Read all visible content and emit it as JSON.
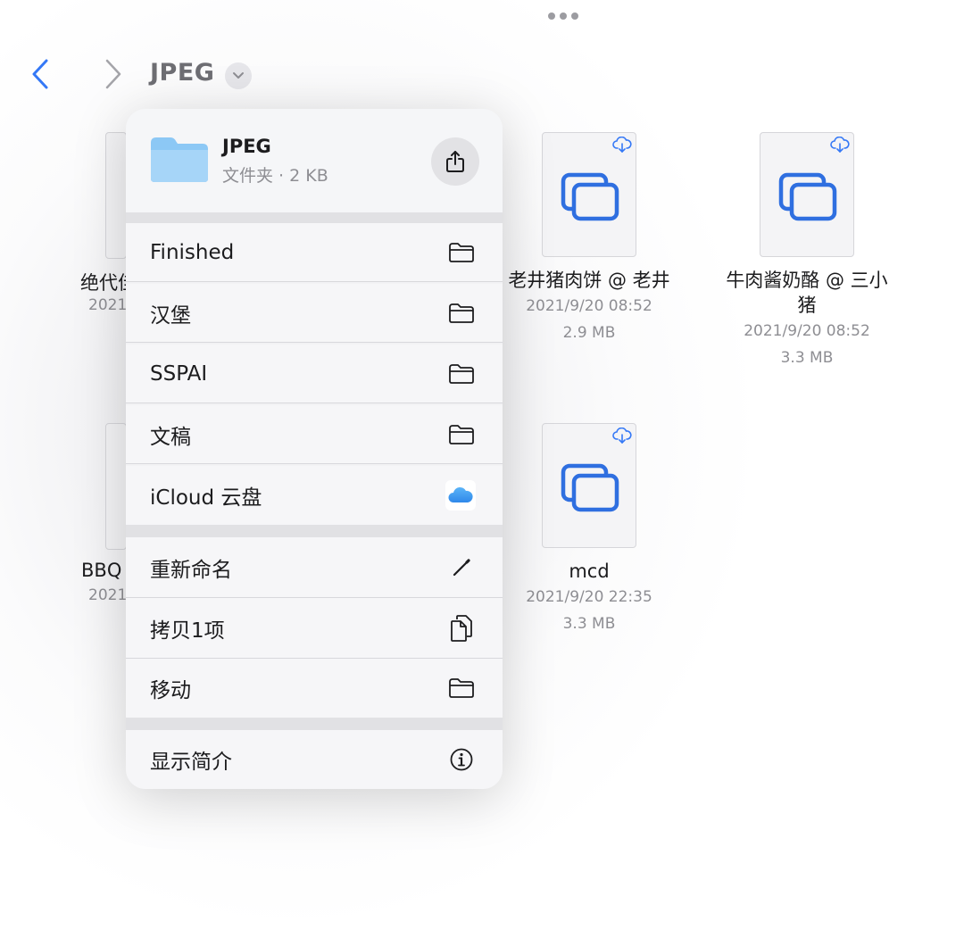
{
  "header": {
    "folder_title": "JPEG"
  },
  "files": [
    {
      "name": "老井猪肉饼 @ 老井",
      "date": "2021/9/20 08:52",
      "size": "2.9 MB"
    },
    {
      "name_line1": "牛肉酱奶酪 @ 三小",
      "name_line2": "猪",
      "date": "2021/9/20 08:52",
      "size": "3.3 MB"
    },
    {
      "name": "mcd",
      "date": "2021/9/20 22:35",
      "size": "3.3 MB"
    }
  ],
  "partial_files": [
    {
      "name": "绝代佳",
      "date": "2021"
    },
    {
      "name": "BBQ",
      "date": "2021"
    }
  ],
  "menu": {
    "title": "JPEG",
    "subtitle": "文件夹 · 2 KB",
    "locations": [
      {
        "label": "Finished",
        "icon": "folder-icon"
      },
      {
        "label": "汉堡",
        "icon": "folder-icon"
      },
      {
        "label": "SSPAI",
        "icon": "folder-icon"
      },
      {
        "label": "文稿",
        "icon": "folder-icon"
      },
      {
        "label": "iCloud 云盘",
        "icon": "icloud-icon"
      }
    ],
    "actions": [
      {
        "label": "重新命名",
        "icon": "pencil-icon"
      },
      {
        "label": "拷贝1项",
        "icon": "copy-icon"
      },
      {
        "label": "移动",
        "icon": "folder-icon"
      }
    ],
    "info": {
      "label": "显示简介",
      "icon": "info-icon"
    }
  },
  "colors": {
    "accent": "#3478f6",
    "file_icon_blue": "#2f6fe0",
    "folder_blue": "#8cc8f5"
  }
}
